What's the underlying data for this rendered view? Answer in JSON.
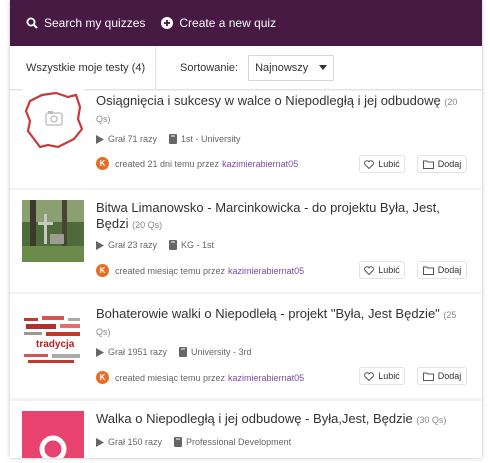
{
  "topbar": {
    "search_label": "Search my quizzes",
    "create_label": "Create a new quiz"
  },
  "filters": {
    "all_tests": "Wszystkie moje testy (4)",
    "sort_label": "Sortowanie:",
    "sort_value": "Najnowszy"
  },
  "actions": {
    "like": "Lubić",
    "add": "Dodaj"
  },
  "colors": {
    "topbar": "#461a42",
    "avatar": "#e86d22",
    "username": "#7c4ba6",
    "pink_thumb": "#e8426e"
  },
  "quizzes": [
    {
      "title": "Osiągnięcia i sukcesy w walce o Niepodległą i jej odbudowę",
      "qs": "(20 Qs)",
      "plays": "Grał 71 razy",
      "grade": "1st - University",
      "created": "created 21 dni temu przez",
      "user": "kazimierabiernat05",
      "avatar": "K",
      "thumb": "poland-map-outline"
    },
    {
      "title": "Bitwa Limanowsko - Marcinkowicka - do projektu Była, Jest, Będzi",
      "qs": "(20 Qs)",
      "plays": "Grał 23 razy",
      "grade": "KG - 1st",
      "created": "created miesiąc temu przez",
      "user": "kazimierabiernat05",
      "avatar": "K",
      "thumb": "cemetery-photo"
    },
    {
      "title": "Bohaterowie walki o Niepodlełą - projekt \"Była, Jest Będzie\"",
      "qs": "(25 Qs)",
      "plays": "Grał 1951 razy",
      "grade": "University - 3rd",
      "created": "created miesiąc temu przez",
      "user": "kazimierabiernat05",
      "avatar": "K",
      "thumb": "word-cloud",
      "thumb_words": [
        "tradycja",
        "historia",
        "kultura"
      ]
    },
    {
      "title": "Walka o Niepodległą i jej odbudowę - Była,Jest, Będzie",
      "qs": "(30 Qs)",
      "plays": "Grał 150 razy",
      "grade": "Professional Development",
      "thumb": "pink-q-logo"
    }
  ]
}
